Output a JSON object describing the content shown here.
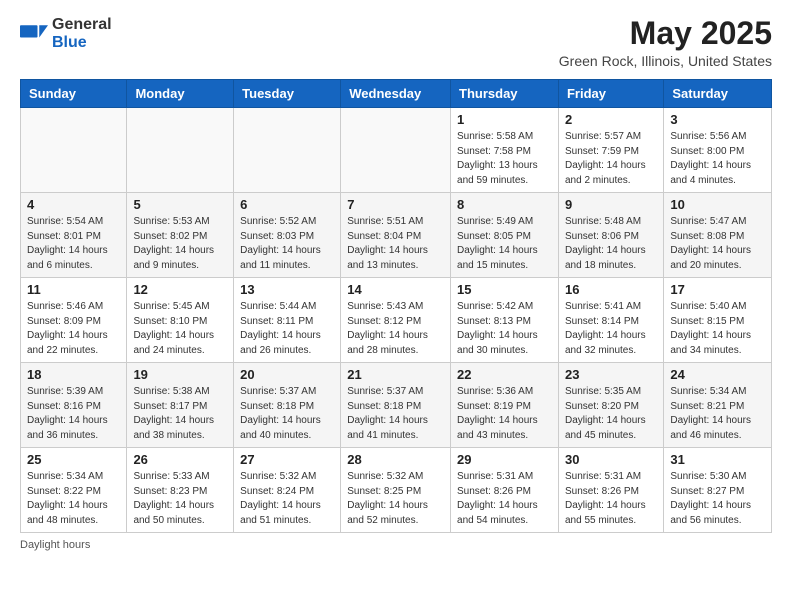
{
  "header": {
    "logo_general": "General",
    "logo_blue": "Blue",
    "month": "May 2025",
    "location": "Green Rock, Illinois, United States"
  },
  "days_of_week": [
    "Sunday",
    "Monday",
    "Tuesday",
    "Wednesday",
    "Thursday",
    "Friday",
    "Saturday"
  ],
  "footer": {
    "daylight_label": "Daylight hours"
  },
  "weeks": [
    [
      {
        "day": "",
        "info": ""
      },
      {
        "day": "",
        "info": ""
      },
      {
        "day": "",
        "info": ""
      },
      {
        "day": "",
        "info": ""
      },
      {
        "day": "1",
        "info": "Sunrise: 5:58 AM\nSunset: 7:58 PM\nDaylight: 13 hours\nand 59 minutes."
      },
      {
        "day": "2",
        "info": "Sunrise: 5:57 AM\nSunset: 7:59 PM\nDaylight: 14 hours\nand 2 minutes."
      },
      {
        "day": "3",
        "info": "Sunrise: 5:56 AM\nSunset: 8:00 PM\nDaylight: 14 hours\nand 4 minutes."
      }
    ],
    [
      {
        "day": "4",
        "info": "Sunrise: 5:54 AM\nSunset: 8:01 PM\nDaylight: 14 hours\nand 6 minutes."
      },
      {
        "day": "5",
        "info": "Sunrise: 5:53 AM\nSunset: 8:02 PM\nDaylight: 14 hours\nand 9 minutes."
      },
      {
        "day": "6",
        "info": "Sunrise: 5:52 AM\nSunset: 8:03 PM\nDaylight: 14 hours\nand 11 minutes."
      },
      {
        "day": "7",
        "info": "Sunrise: 5:51 AM\nSunset: 8:04 PM\nDaylight: 14 hours\nand 13 minutes."
      },
      {
        "day": "8",
        "info": "Sunrise: 5:49 AM\nSunset: 8:05 PM\nDaylight: 14 hours\nand 15 minutes."
      },
      {
        "day": "9",
        "info": "Sunrise: 5:48 AM\nSunset: 8:06 PM\nDaylight: 14 hours\nand 18 minutes."
      },
      {
        "day": "10",
        "info": "Sunrise: 5:47 AM\nSunset: 8:08 PM\nDaylight: 14 hours\nand 20 minutes."
      }
    ],
    [
      {
        "day": "11",
        "info": "Sunrise: 5:46 AM\nSunset: 8:09 PM\nDaylight: 14 hours\nand 22 minutes."
      },
      {
        "day": "12",
        "info": "Sunrise: 5:45 AM\nSunset: 8:10 PM\nDaylight: 14 hours\nand 24 minutes."
      },
      {
        "day": "13",
        "info": "Sunrise: 5:44 AM\nSunset: 8:11 PM\nDaylight: 14 hours\nand 26 minutes."
      },
      {
        "day": "14",
        "info": "Sunrise: 5:43 AM\nSunset: 8:12 PM\nDaylight: 14 hours\nand 28 minutes."
      },
      {
        "day": "15",
        "info": "Sunrise: 5:42 AM\nSunset: 8:13 PM\nDaylight: 14 hours\nand 30 minutes."
      },
      {
        "day": "16",
        "info": "Sunrise: 5:41 AM\nSunset: 8:14 PM\nDaylight: 14 hours\nand 32 minutes."
      },
      {
        "day": "17",
        "info": "Sunrise: 5:40 AM\nSunset: 8:15 PM\nDaylight: 14 hours\nand 34 minutes."
      }
    ],
    [
      {
        "day": "18",
        "info": "Sunrise: 5:39 AM\nSunset: 8:16 PM\nDaylight: 14 hours\nand 36 minutes."
      },
      {
        "day": "19",
        "info": "Sunrise: 5:38 AM\nSunset: 8:17 PM\nDaylight: 14 hours\nand 38 minutes."
      },
      {
        "day": "20",
        "info": "Sunrise: 5:37 AM\nSunset: 8:18 PM\nDaylight: 14 hours\nand 40 minutes."
      },
      {
        "day": "21",
        "info": "Sunrise: 5:37 AM\nSunset: 8:18 PM\nDaylight: 14 hours\nand 41 minutes."
      },
      {
        "day": "22",
        "info": "Sunrise: 5:36 AM\nSunset: 8:19 PM\nDaylight: 14 hours\nand 43 minutes."
      },
      {
        "day": "23",
        "info": "Sunrise: 5:35 AM\nSunset: 8:20 PM\nDaylight: 14 hours\nand 45 minutes."
      },
      {
        "day": "24",
        "info": "Sunrise: 5:34 AM\nSunset: 8:21 PM\nDaylight: 14 hours\nand 46 minutes."
      }
    ],
    [
      {
        "day": "25",
        "info": "Sunrise: 5:34 AM\nSunset: 8:22 PM\nDaylight: 14 hours\nand 48 minutes."
      },
      {
        "day": "26",
        "info": "Sunrise: 5:33 AM\nSunset: 8:23 PM\nDaylight: 14 hours\nand 50 minutes."
      },
      {
        "day": "27",
        "info": "Sunrise: 5:32 AM\nSunset: 8:24 PM\nDaylight: 14 hours\nand 51 minutes."
      },
      {
        "day": "28",
        "info": "Sunrise: 5:32 AM\nSunset: 8:25 PM\nDaylight: 14 hours\nand 52 minutes."
      },
      {
        "day": "29",
        "info": "Sunrise: 5:31 AM\nSunset: 8:26 PM\nDaylight: 14 hours\nand 54 minutes."
      },
      {
        "day": "30",
        "info": "Sunrise: 5:31 AM\nSunset: 8:26 PM\nDaylight: 14 hours\nand 55 minutes."
      },
      {
        "day": "31",
        "info": "Sunrise: 5:30 AM\nSunset: 8:27 PM\nDaylight: 14 hours\nand 56 minutes."
      }
    ]
  ]
}
